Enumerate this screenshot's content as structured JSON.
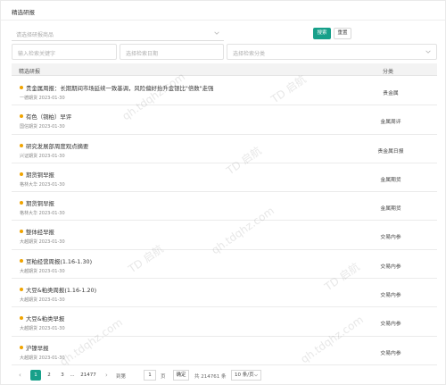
{
  "page": {
    "title": "精选研报"
  },
  "filters": {
    "research_select_placeholder": "请选择研报商品",
    "search_label": "搜索",
    "reset_label": "重置",
    "keyword_placeholder": "输入检索关键字",
    "date_placeholder": "选择检索日期",
    "category_placeholder": "选择检索分类"
  },
  "table": {
    "col_title": "精选研报",
    "col_category": "分类",
    "rows": [
      {
        "name": "贵金属周报：长期期间市场延续一致基调，风险偏好抬升金银比\"倍数\"走强",
        "meta": "一德期货 2023-01-30",
        "category": "贵金属"
      },
      {
        "name": "有色（铜柏）早评",
        "meta": "国信期货 2023-01-30",
        "category": "金属周评"
      },
      {
        "name": "研究发展部周度观点摘要",
        "meta": "兴证期货 2023-01-30",
        "category": "贵金属日报"
      },
      {
        "name": "期货铜早报",
        "meta": "格林大华 2023-01-30",
        "category": "金属期货"
      },
      {
        "name": "期货铜早报",
        "meta": "格林大华 2023-01-30",
        "category": "金属期货"
      },
      {
        "name": "整体经早报",
        "meta": "大越期货 2023-01-30",
        "category": "交易内参"
      },
      {
        "name": "豆粕经营周报(1.16-1.30)",
        "meta": "大越期货 2023-01-30",
        "category": "交易内参"
      },
      {
        "name": "大豆&粕类周报(1.16-1.20)",
        "meta": "大越期货 2023-01-30",
        "category": "交易内参"
      },
      {
        "name": "大豆&粕类早报",
        "meta": "大越期货 2023-01-30",
        "category": "交易内参"
      },
      {
        "name": "沪镍早报",
        "meta": "大越期货 2023-01-30",
        "category": "交易内参"
      }
    ]
  },
  "pager": {
    "pages": [
      "1",
      "2",
      "3",
      "...",
      "21477"
    ],
    "goto_label": "到第",
    "page_input": "1",
    "page_unit": "页",
    "confirm_label": "确定",
    "total_label": "共 214761 条",
    "size_label": "10 条/页"
  },
  "watermarks": [
    "qh.tdqhz.com",
    "TD 启航"
  ],
  "colors": {
    "accent": "#17a08a",
    "dot": "#f0a400"
  }
}
